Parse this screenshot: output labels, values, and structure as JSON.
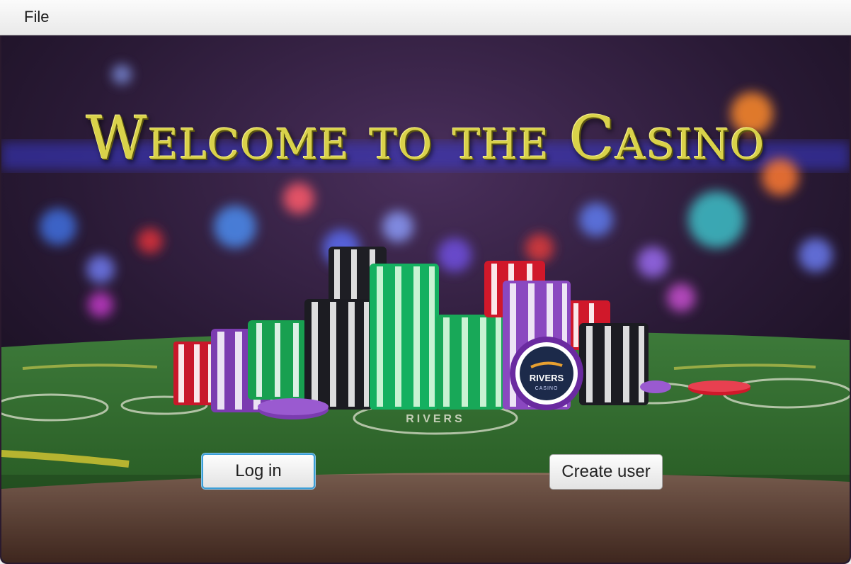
{
  "menubar": {
    "items": [
      {
        "label": "File"
      }
    ]
  },
  "hero": {
    "title": "Welcome to the Casino",
    "chip_brand": "RIVERS",
    "chip_sub": "CASINO",
    "table_logo": "RIVERS"
  },
  "actions": {
    "login_label": "Log in",
    "create_user_label": "Create user"
  },
  "colors": {
    "title_gold": "#d9d24a",
    "felt_green": "#2f6b2c",
    "focus_ring": "#3b9fd8"
  }
}
